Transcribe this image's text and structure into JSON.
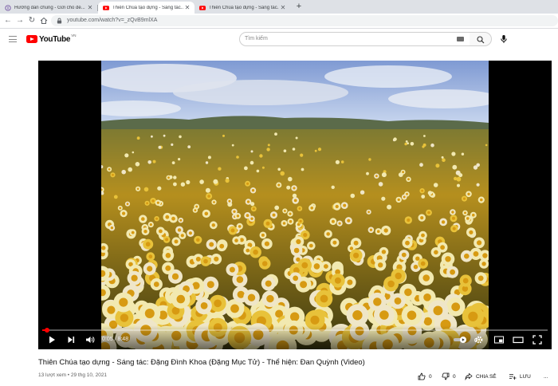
{
  "browser": {
    "tabs": [
      {
        "title": "Hướng dẫn chung - Gửi cho đề...",
        "active": false
      },
      {
        "title": "Thiên Chúa tạo dựng - Sáng tác...",
        "active": true
      },
      {
        "title": "Thiên Chúa tạo dựng - Sáng tác...",
        "active": false
      }
    ],
    "new_tab": "+",
    "url": "youtube.com/watch?v=_zQvB9mlXA"
  },
  "youtube": {
    "logo_text": "YouTube",
    "region": "VN",
    "search_placeholder": "Tìm kiếm"
  },
  "player": {
    "current_time": "0:05",
    "duration": "8:48",
    "time_display": "0:05 / 8:48",
    "progress": 0.0095
  },
  "video": {
    "title": "Thiên Chúa tạo dựng - Sáng tác: Đặng Đình Khoa (Đặng Mục Tử) - Thể hiện: Đan Quỳnh (Video)",
    "views": "13 lượt xem",
    "date": "29 thg 10, 2021",
    "meta": "13 lượt xem • 29 thg 10, 2021",
    "likes": "0",
    "dislikes": "0",
    "share_label": "CHIA SẺ",
    "save_label": "LƯU",
    "more_label": "..."
  },
  "colors": {
    "brand": "#ff0000",
    "tabstrip": "#dee1e6",
    "player_bg": "#000000"
  }
}
